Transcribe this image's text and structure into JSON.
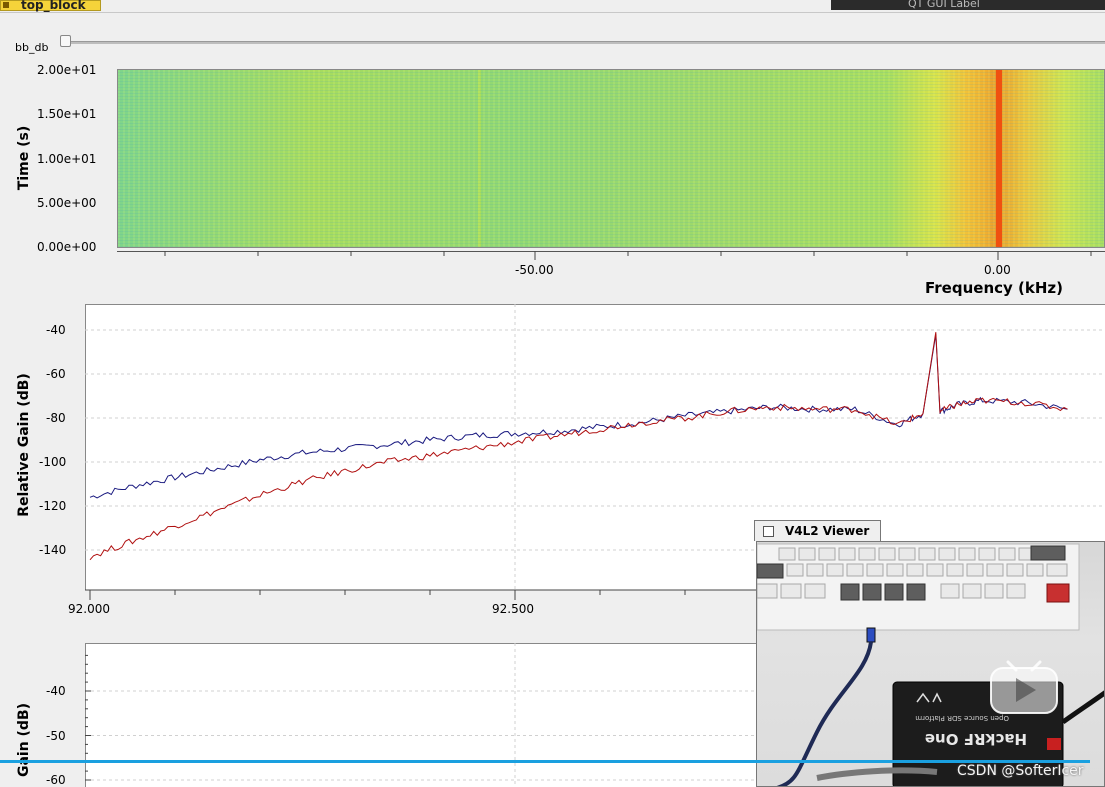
{
  "window": {
    "tab_label": "top_block",
    "header_label": "QT GUI Label"
  },
  "slider": {
    "label": "bb_db",
    "position_fraction": 0.0
  },
  "waterfall": {
    "ylabel": "Time (s)",
    "xlabel": "Frequency (kHz)",
    "yticks": [
      "2.00e+01",
      "1.50e+01",
      "1.00e+01",
      "5.00e+00",
      "0.00e+00"
    ],
    "xticks": [
      "-50.00",
      "0.00"
    ]
  },
  "chart_data": [
    {
      "type": "line",
      "ylabel": "Relative Gain (dB)",
      "xlabel": "",
      "xlim": [
        92.0,
        92.8
      ],
      "ylim": [
        -150,
        -30
      ],
      "yticks": [
        "-40",
        "-60",
        "-80",
        "-100",
        "-120",
        "-140"
      ],
      "xticks": [
        "92.000",
        "92.500"
      ],
      "grid": true,
      "series": [
        {
          "color": "#1a1a80",
          "x": [
            92.0,
            92.05,
            92.1,
            92.15,
            92.2,
            92.25,
            92.3,
            92.35,
            92.4,
            92.45,
            92.5,
            92.55,
            92.6,
            92.65,
            92.7,
            92.75,
            92.8,
            92.85,
            92.9,
            92.95,
            92.98,
            92.995,
            93.0,
            93.02,
            93.05,
            93.1,
            93.15
          ],
          "y": [
            -116,
            -111,
            -107,
            -103,
            -99,
            -96,
            -94,
            -92,
            -90,
            -88,
            -87,
            -86,
            -84,
            -82,
            -79,
            -77,
            -75,
            -76,
            -76,
            -83,
            -78,
            -42,
            -77,
            -74,
            -72,
            -73,
            -76
          ]
        },
        {
          "color": "#b01010",
          "x": [
            92.0,
            92.05,
            92.1,
            92.15,
            92.2,
            92.25,
            92.3,
            92.35,
            92.4,
            92.45,
            92.5,
            92.55,
            92.6,
            92.65,
            92.7,
            92.75,
            92.8,
            92.85,
            92.9,
            92.95,
            92.98,
            92.995,
            93.0,
            93.02,
            93.05,
            93.1,
            93.15
          ],
          "y": [
            -143,
            -136,
            -129,
            -122,
            -115,
            -109,
            -104,
            -100,
            -97,
            -94,
            -91,
            -88,
            -85,
            -82,
            -80,
            -77,
            -75,
            -76,
            -76,
            -83,
            -78,
            -41,
            -77,
            -74,
            -72,
            -73,
            -76
          ]
        }
      ]
    },
    {
      "type": "line",
      "ylabel": "Gain (dB)",
      "xlabel": "",
      "ylim": [
        -62,
        -30
      ],
      "yticks": [
        "-40",
        "-50",
        "-60"
      ],
      "grid": true,
      "series": []
    }
  ],
  "viewer": {
    "title": "V4L2 Viewer",
    "device_label": "HackRF One",
    "device_sublabel": "Open Source SDR Platform"
  },
  "overlay": {
    "watermark": "CSDN @SofterIcer"
  }
}
